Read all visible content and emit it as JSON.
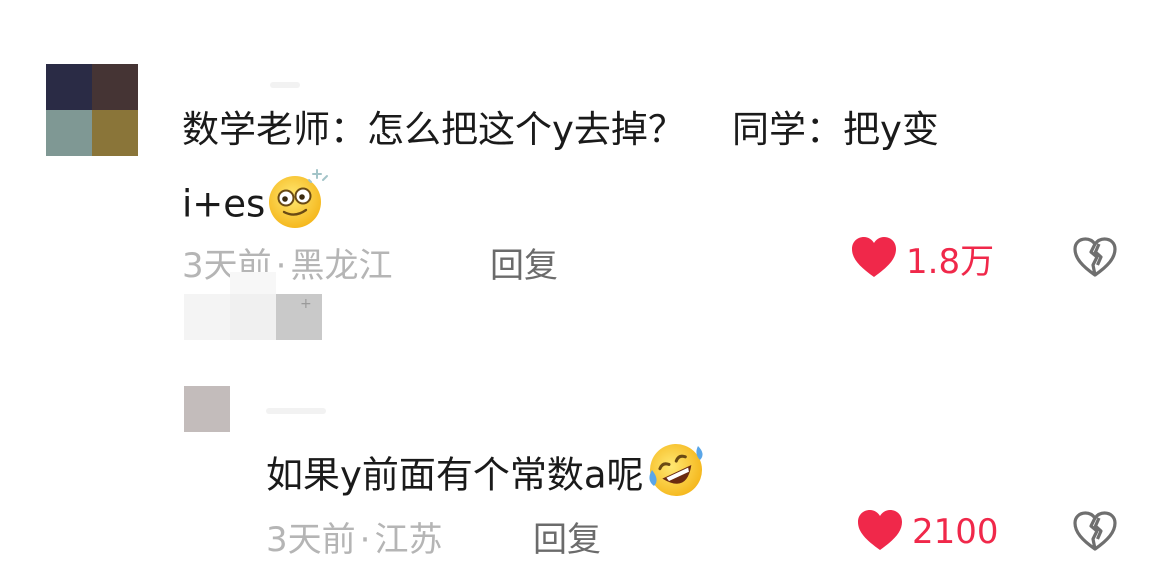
{
  "comment": {
    "text_line1": "数学老师：怎么把这个y去掉？    同学：把y变",
    "text_line2": "i+es",
    "emoji": "dizzy-face-emoji",
    "time": "3天前",
    "separator": "·",
    "location": "黑龙江",
    "reply_label": "回复",
    "like_count": "1.8万",
    "avatar_colors": [
      "#2a2b45",
      "#453434",
      "#7f9894",
      "#8a7539"
    ]
  },
  "reply": {
    "text": "如果y前面有个常数a呢",
    "emoji": "rolling-on-floor-laughing-emoji",
    "time": "3天前",
    "separator": "·",
    "location": "江苏",
    "reply_label": "回复",
    "like_count": "2100",
    "avatar_color": "#c3bcbb"
  },
  "colors": {
    "like": "#f0284a",
    "meta": "#b5b5b5",
    "reply": "#6b6b6b",
    "text": "#1a1a1a"
  }
}
